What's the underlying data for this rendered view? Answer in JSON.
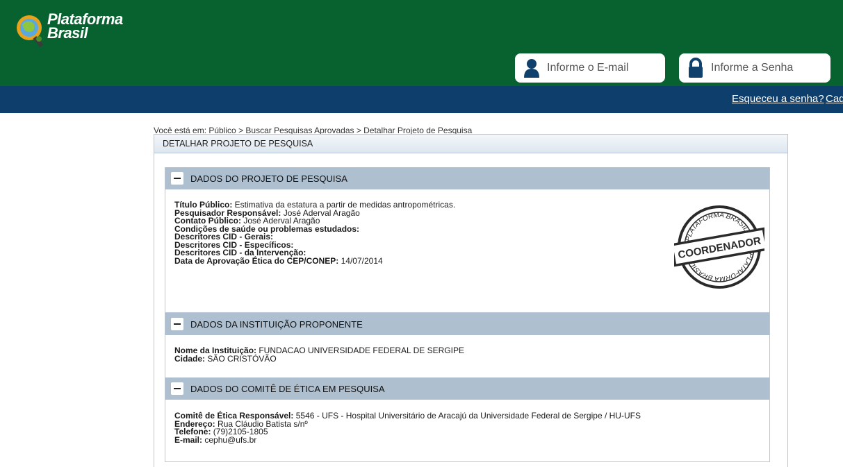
{
  "header": {
    "brand_line1": "Plataforma",
    "brand_line2": "Brasil",
    "email_placeholder": "Informe o E-mail",
    "password_placeholder": "Informe a Senha",
    "user_icon": "user-icon",
    "lock_icon": "lock-icon"
  },
  "nav": {
    "forgot_password": "Esqueceu a senha?",
    "register": "Cad"
  },
  "breadcrumb": "Você está em: Público > Buscar Pesquisas Aprovadas > Detalhar Projeto de Pesquisa",
  "page_title": "DETALHAR PROJETO DE PESQUISA",
  "sections": [
    {
      "title": "DADOS DO PROJETO DE PESQUISA",
      "rows": [
        {
          "label": "Título Público:",
          "value": " Estimativa da estatura a partir de medidas antropométricas."
        },
        {
          "label": "Pesquisador Responsável:",
          "value": " José Aderval Aragão"
        },
        {
          "label": "Contato Público:",
          "value": " José Aderval Aragão"
        },
        {
          "label": "Condições de saúde ou problemas estudados:",
          "value": ""
        },
        {
          "label": "Descritores CID - Gerais:",
          "value": ""
        },
        {
          "label": "Descritores CID - Específicos:",
          "value": ""
        },
        {
          "label": "Descritores CID - da Intervenção:",
          "value": ""
        },
        {
          "label": "Data de Aprovação Ética do CEP/CONEP:",
          "value": " 14/07/2014"
        }
      ],
      "stamp": {
        "top_text": "PLATAFORMA BRASIL",
        "center_text": "COORDENADOR",
        "bottom_text": "PLATAFORMA BRASIL"
      }
    },
    {
      "title": "DADOS DA INSTITUIÇÃO PROPONENTE",
      "rows": [
        {
          "label": "Nome da Instituição:",
          "value": " FUNDACAO UNIVERSIDADE FEDERAL DE SERGIPE"
        },
        {
          "label": "Cidade:",
          "value": " SÃO CRISTÓVÃO"
        }
      ]
    },
    {
      "title": "DADOS DO COMITÊ DE ÉTICA EM PESQUISA",
      "rows": [
        {
          "label": "Comitê de Ética Responsável:",
          "value": " 5546 - UFS - Hospital Universitário de Aracajú da Universidade Federal de Sergipe / HU-UFS"
        },
        {
          "label": "Endereço:",
          "value": " Rua Cláudio Batista s/nº"
        },
        {
          "label": "Telefone:",
          "value": " (79)2105-1805"
        },
        {
          "label": "E-mail:",
          "value": " cephu@ufs.br"
        }
      ]
    }
  ],
  "colors": {
    "header_green": "#076230",
    "nav_blue": "#0e3e6b",
    "section_header": "#aebfd0"
  }
}
